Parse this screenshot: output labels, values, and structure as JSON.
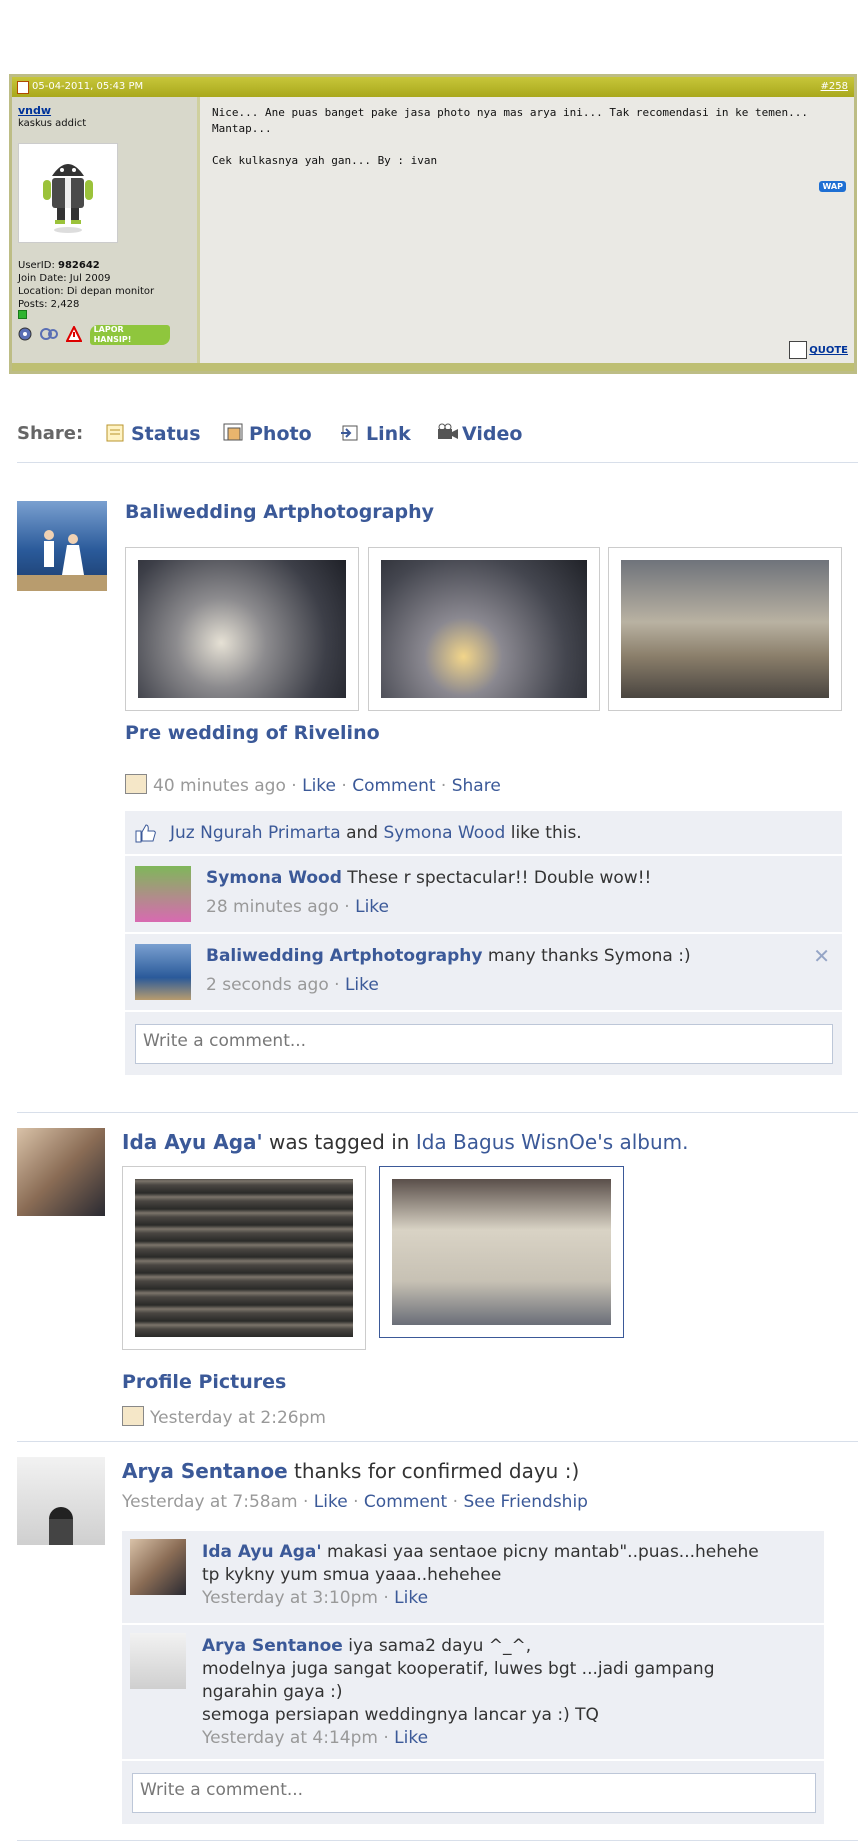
{
  "kaskus": {
    "date": "05-04-2011, 05:43 PM",
    "post_number": "#258",
    "username": "vndw",
    "user_title": "kaskus addict",
    "userid_label": "UserID:",
    "userid": "982642",
    "join_date": "Join Date: Jul 2009",
    "location": "Location: Di depan monitor",
    "posts": "Posts: 2,428",
    "lapor_label": "LAPOR\nHANSIP!",
    "message": "Nice... Ane puas banget pake jasa photo nya mas arya ini... Tak recomendasi in ke temen...\nMantap...\n\nCek kulkasnya yah gan... By : ivan",
    "wap_label": "WAP",
    "quote_label": "QUOTE"
  },
  "share": {
    "label": "Share:",
    "items": [
      "Status",
      "Photo",
      "Link",
      "Video"
    ]
  },
  "post1": {
    "author": "Baliwedding Artphotography",
    "album": "Pre wedding of Rivelino",
    "time": "40 minutes ago",
    "actions": [
      "Like",
      "Comment",
      "Share"
    ],
    "likers": [
      "Juz Ngurah Primarta",
      "Symona Wood"
    ],
    "likes_suffix": "like this.",
    "likes_and": "and",
    "comments": [
      {
        "name": "Symona Wood",
        "text": "These r spectacular!! Double wow!!",
        "time": "28 minutes ago",
        "action": "Like"
      },
      {
        "name": "Baliwedding Artphotography",
        "text": "many thanks Symona :)",
        "time": "2 seconds ago",
        "action": "Like"
      }
    ],
    "comment_placeholder": "Write a comment..."
  },
  "post2": {
    "author": "Ida Ayu Aga'",
    "tagged_text": "was tagged in",
    "album_owner": "Ida Bagus WisnOe's",
    "album_word": "album.",
    "album": "Profile Pictures",
    "time": "Yesterday at 2:26pm"
  },
  "post3": {
    "author": "Arya Sentanoe",
    "text": "thanks for confirmed dayu :)",
    "time": "Yesterday at 7:58am",
    "actions": [
      "Like",
      "Comment",
      "See Friendship"
    ],
    "comments": [
      {
        "name": "Ida Ayu Aga'",
        "text": "makasi yaa sentaoe picny mantab\"..puas...hehehe",
        "text2": "tp kykny yum smua yaaa..hehehee",
        "time": "Yesterday at 3:10pm",
        "action": "Like"
      },
      {
        "name": "Arya Sentanoe",
        "text": "iya sama2 dayu ^_^,",
        "text2": "modelnya juga sangat kooperatif, luwes bgt ...jadi gampang",
        "text3": "ngarahin gaya :)",
        "text4": "semoga persiapan weddingnya lancar ya :) TQ",
        "time": "Yesterday at 4:14pm",
        "action": "Like"
      }
    ],
    "comment_placeholder": "Write a comment..."
  },
  "colors": {
    "fb_link": "#3b5998",
    "kaskus_header": "#b8b72a",
    "fb_comment_bg": "#edeff4"
  }
}
